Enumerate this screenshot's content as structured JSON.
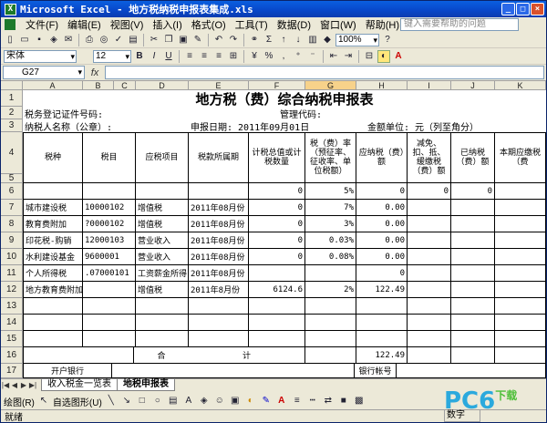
{
  "title": "Microsoft Excel - 地方税纳税申报表集成.xls",
  "menu": [
    "文件(F)",
    "编辑(E)",
    "视图(V)",
    "插入(I)",
    "格式(O)",
    "工具(T)",
    "数据(D)",
    "窗口(W)",
    "帮助(H)"
  ],
  "help_placeholder": "键入需要帮助的问题",
  "toolbar": {
    "zoom": "100%",
    "font": "宋体",
    "size": "12"
  },
  "namebox": "G27",
  "fx": "fx",
  "columns": [
    "A",
    "B",
    "C",
    "D",
    "E",
    "F",
    "G",
    "H",
    "I",
    "J",
    "K",
    "L"
  ],
  "sheet": {
    "title": "地方税（费）综合纳税申报表",
    "row2_left": "税务登记证件号码:",
    "row2_right": "管理代码:",
    "row3_left": "纳税人名称（公章）:",
    "row3_mid": "申报日期: 2011年09月01日",
    "row3_right": "金额单位: 元（列至角分）",
    "headers": {
      "tax_kind": "税种",
      "tax_item": "税目",
      "item": "应税项目",
      "period": "税款所属期",
      "base": "计税总值或计税数量",
      "rate": "税（费）率（预征率、征收率、单位税额）",
      "payable": "应纳税（费）额",
      "reduce": "减免、扣、抵、缓缴税（费）额",
      "paid": "已纳税（费）额",
      "current": "本期应缴税（费"
    },
    "row6": {
      "base": "0",
      "rate": "5%",
      "payable": "0",
      "reduce": "0",
      "paid": "0"
    },
    "rows": [
      {
        "kind": "城市建设税",
        "code": "10000102",
        "item": "增值税",
        "period": "2011年08月份",
        "base": "0",
        "rate": "7%",
        "payable": "0.00"
      },
      {
        "kind": "教育费附加",
        "code": "?0000102",
        "item": "增值税",
        "period": "2011年08月份",
        "base": "0",
        "rate": "3%",
        "payable": "0.00"
      },
      {
        "kind": "印花税-购销",
        "code": "12000103",
        "item": "营业收入",
        "period": "2011年08月份",
        "base": "0",
        "rate": "0.03%",
        "payable": "0.00"
      },
      {
        "kind": "水利建设基金",
        "code": "9600001",
        "item": "营业收入",
        "period": "2011年08月份",
        "base": "0",
        "rate": "0.08%",
        "payable": "0.00"
      },
      {
        "kind": "个人所得税",
        "code": ".07000101",
        "item": "工资薪金所得",
        "period": "2011年08月份",
        "base": "",
        "rate": "",
        "payable": "0"
      },
      {
        "kind": "地方教育费附加",
        "code": "",
        "item": "增值税",
        "period": "2011年8月份",
        "base": "6124.6",
        "rate": "2%",
        "payable": "122.49"
      }
    ],
    "total_label_1": "合",
    "total_label_2": "计",
    "total_value": "122.49",
    "bank_label": "开户银行",
    "account_label": "银行帐号"
  },
  "row_numbers": [
    "1",
    "2",
    "3",
    "4",
    "5",
    "6",
    "7",
    "8",
    "9",
    "10",
    "11",
    "12",
    "13",
    "14",
    "15",
    "16",
    "17"
  ],
  "sheet_tabs": [
    "收入税金一览表",
    "地税申报表"
  ],
  "draw_label": "绘图(R)",
  "autoshape_label": "自选图形(U)",
  "status": {
    "left": "就绪",
    "num": "数字"
  },
  "watermark": {
    "main": "PC6",
    "sub": "下载"
  }
}
